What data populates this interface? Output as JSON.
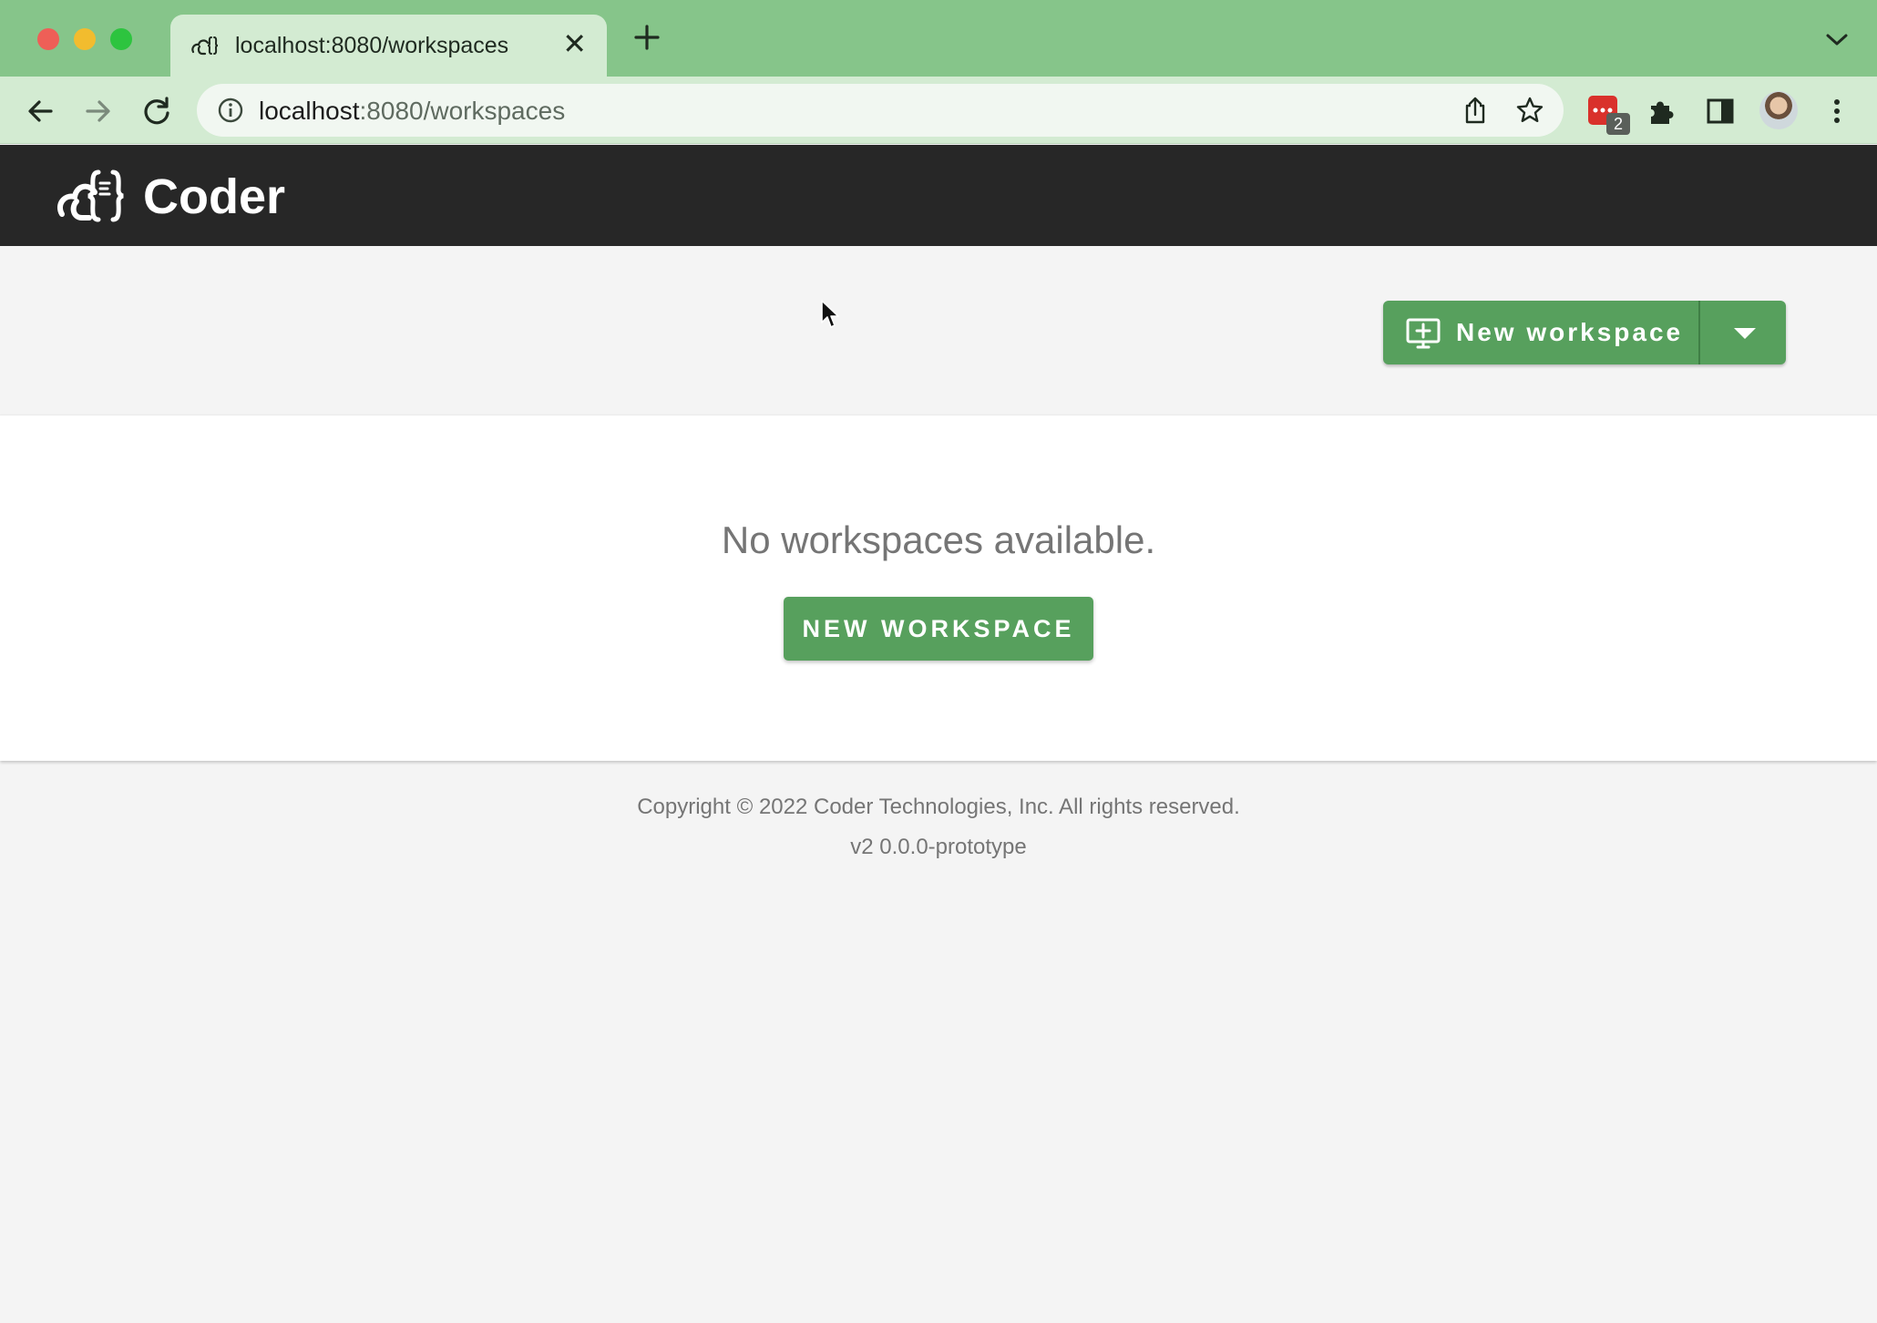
{
  "browser": {
    "tab": {
      "title": "localhost:8080/workspaces",
      "close_glyph": "✕"
    },
    "url": {
      "host": "localhost",
      "rest": ":8080/workspaces"
    },
    "extension_badge": "2",
    "icons": [
      "back-icon",
      "forward-icon",
      "reload-icon",
      "info-icon",
      "share-icon",
      "bookmark-star-icon",
      "extension-icon",
      "puzzle-icon",
      "side-panel-icon",
      "profile-avatar",
      "menu-dots-icon",
      "new-tab-icon",
      "tab-list-icon"
    ]
  },
  "app": {
    "brand": "Coder",
    "actions": {
      "new_workspace_label": "New workspace"
    },
    "empty_state": {
      "message": "No workspaces available.",
      "button_label": "NEW WORKSPACE"
    },
    "footer": {
      "copyright": "Copyright © 2022 Coder Technologies, Inc. All rights reserved.",
      "version": "v2 0.0.0-prototype"
    }
  },
  "colors": {
    "chrome_green": "#86c58a",
    "toolbar_green": "#d3ebd2",
    "header_dark": "#272727",
    "accent_green": "#57a05d",
    "page_bg": "#f4f4f4"
  }
}
